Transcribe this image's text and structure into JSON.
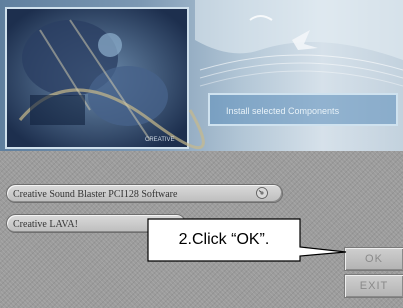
{
  "banner": {
    "caption": "Install selected Components",
    "logo_text": "CREATIVE"
  },
  "items": [
    {
      "label": "Creative Sound Blaster PCI128 Software",
      "icon": "cd-icon"
    },
    {
      "label": "Creative LAVA!"
    }
  ],
  "buttons": {
    "ok": "OK",
    "exit": "EXIT"
  },
  "annotation": {
    "text": "2.Click “OK”."
  }
}
